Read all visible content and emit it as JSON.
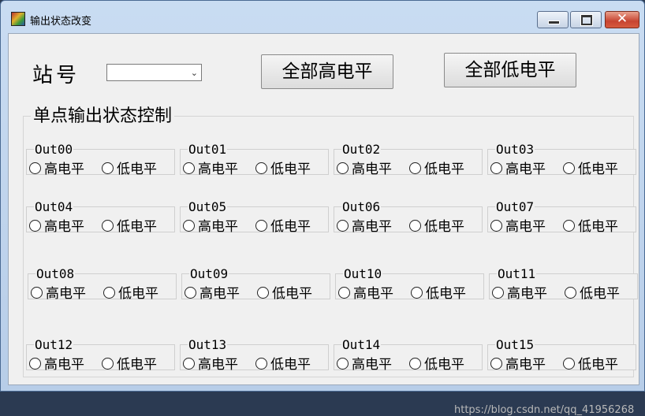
{
  "window": {
    "title": "输出状态改变"
  },
  "controls": {
    "close_glyph": "✕"
  },
  "station": {
    "label": "站号",
    "selected": "",
    "arrow": "⌄"
  },
  "buttons": {
    "all_high": "全部高电平",
    "all_low": "全部低电平"
  },
  "group": {
    "title": "单点输出状态控制"
  },
  "option_labels": {
    "high": "高电平",
    "low": "低电平"
  },
  "outputs": [
    {
      "name": "Out00"
    },
    {
      "name": "Out01"
    },
    {
      "name": "Out02"
    },
    {
      "name": "Out03"
    },
    {
      "name": "Out04"
    },
    {
      "name": "Out05"
    },
    {
      "name": "Out06"
    },
    {
      "name": "Out07"
    },
    {
      "name": "Out08"
    },
    {
      "name": "Out09"
    },
    {
      "name": "Out10"
    },
    {
      "name": "Out11"
    },
    {
      "name": "Out12"
    },
    {
      "name": "Out13"
    },
    {
      "name": "Out14"
    },
    {
      "name": "Out15"
    }
  ],
  "watermark": "https://blog.csdn.net/qq_41956268"
}
